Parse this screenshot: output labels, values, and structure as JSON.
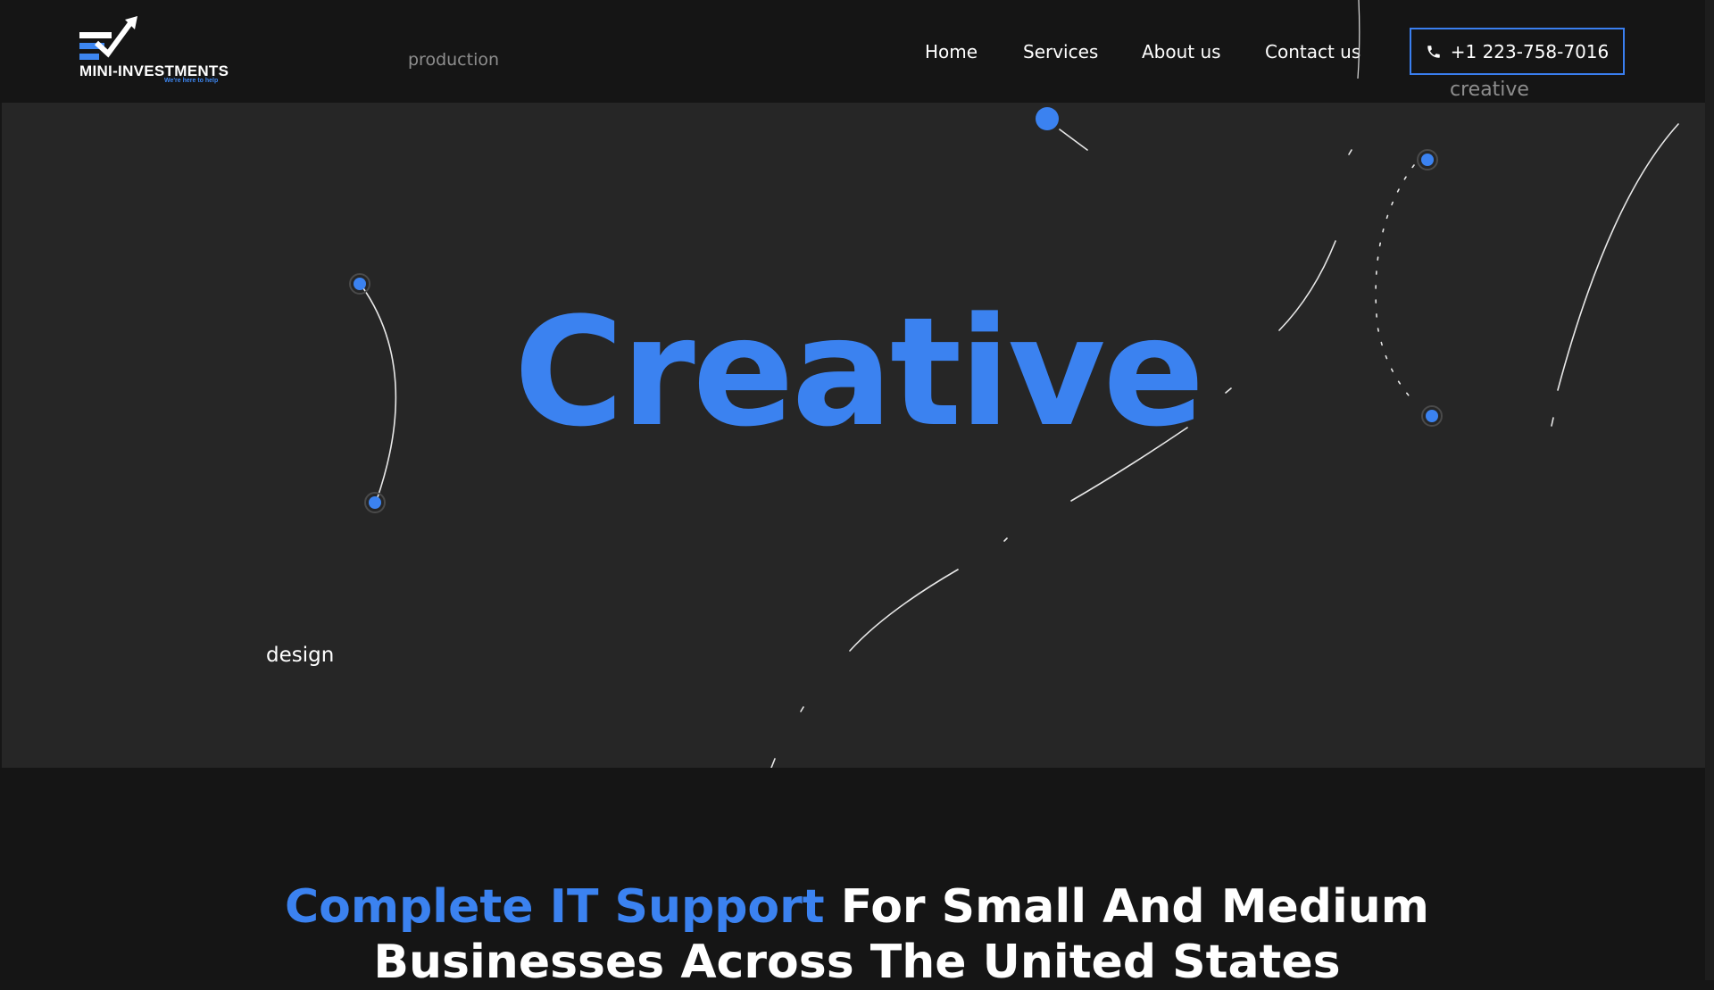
{
  "brand": {
    "name": "MINI-INVESTMENTS",
    "tagline": "We're here to help",
    "accent": "#3b82f0",
    "icon": "chart-check-logo-icon"
  },
  "nav": {
    "items": [
      {
        "label": "Home"
      },
      {
        "label": "Services"
      },
      {
        "label": "About us"
      },
      {
        "label": "Contact us"
      }
    ],
    "phone": {
      "label": "+1 223-758-7016",
      "icon": "phone-icon"
    }
  },
  "hero": {
    "title": "Creative",
    "floating_words": {
      "production": "production",
      "creative": "creative",
      "design": "design"
    }
  },
  "section": {
    "headline_accent": "Complete IT Support",
    "headline_rest": " For Small And Medium",
    "headline_line2": "Businesses Across The United States"
  },
  "colors": {
    "background": "#151515",
    "hero_background": "#262626",
    "accent": "#3b82f0",
    "text": "#ffffff"
  }
}
